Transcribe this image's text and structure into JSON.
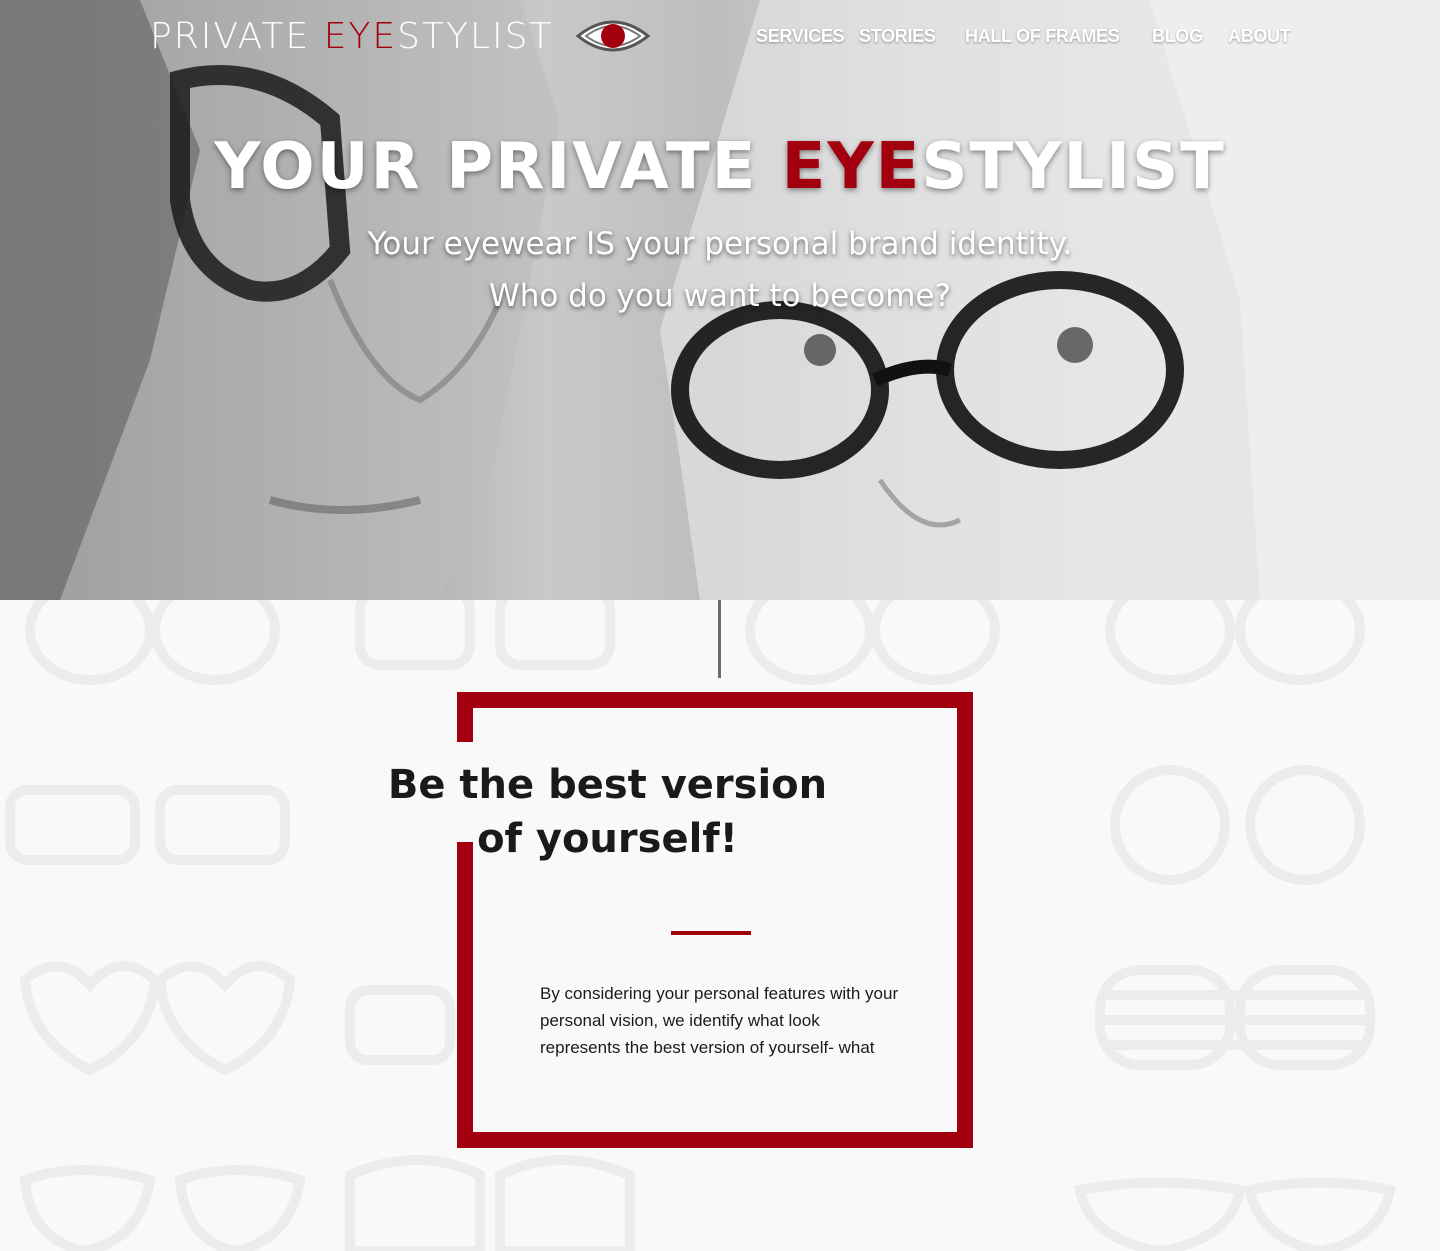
{
  "logo": {
    "part1": "PRIVATE ",
    "accent": "EYE",
    "part2": "STYLIST"
  },
  "nav": {
    "items": [
      {
        "label": "SERVICES"
      },
      {
        "label": "STORIES"
      },
      {
        "label": "HALL OF FRAMES"
      },
      {
        "label": "BLOG"
      },
      {
        "label": "ABOUT"
      }
    ]
  },
  "hero": {
    "title_part1": "YOUR PRIVATE ",
    "title_accent": "EYE",
    "title_part2": "STYLIST",
    "subtitle_line1": "Your eyewear IS your personal brand identity.",
    "subtitle_line2": "Who do you want to become?"
  },
  "card": {
    "title": "Be the best version of yourself!",
    "body": "By considering your personal features with your personal vision, we identify what look represents the best version of yourself- what"
  },
  "colors": {
    "accent": "#a3000f",
    "text_dark": "#1a1a1a",
    "white": "#ffffff"
  }
}
